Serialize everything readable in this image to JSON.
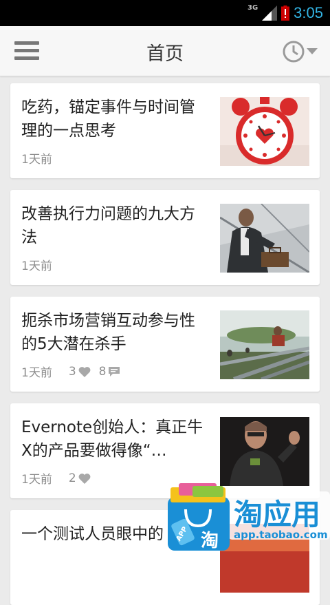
{
  "status_bar": {
    "network": "3G",
    "time": "3:05"
  },
  "app_bar": {
    "title": "首页"
  },
  "articles": [
    {
      "title": "吃药，锚定事件与时间管理的一点思考",
      "time": "1天前",
      "likes": "",
      "comments": "",
      "image": "alarm-clock-photo"
    },
    {
      "title": "改善执行力问题的九大方法",
      "time": "1天前",
      "likes": "",
      "comments": "",
      "image": "businessman-thinking-photo"
    },
    {
      "title": "扼杀市场营销互动参与性的5大潜在杀手",
      "time": "1天前",
      "likes": "3",
      "comments": "8",
      "image": "obstacle-course-photo"
    },
    {
      "title": "Evernote创始人：真正牛X的产品要做得像“…",
      "time": "1天前",
      "likes": "2",
      "comments": "",
      "image": "speaker-on-stage-photo"
    },
    {
      "title": "一个测试人员眼中的",
      "time": "",
      "likes": "",
      "comments": "",
      "image": "partial-photo"
    }
  ],
  "watermark": {
    "brand": "淘应用",
    "url": "app.taobao.com",
    "badge": "APP",
    "glyph": "淘"
  },
  "colors": {
    "accent": "#33b5e5",
    "card_bg": "#ffffff",
    "page_bg": "#ebebeb",
    "appbar_bg": "#f7f7f7",
    "meta_text": "#8e8e8e",
    "watermark_blue": "#1a8fd6"
  }
}
